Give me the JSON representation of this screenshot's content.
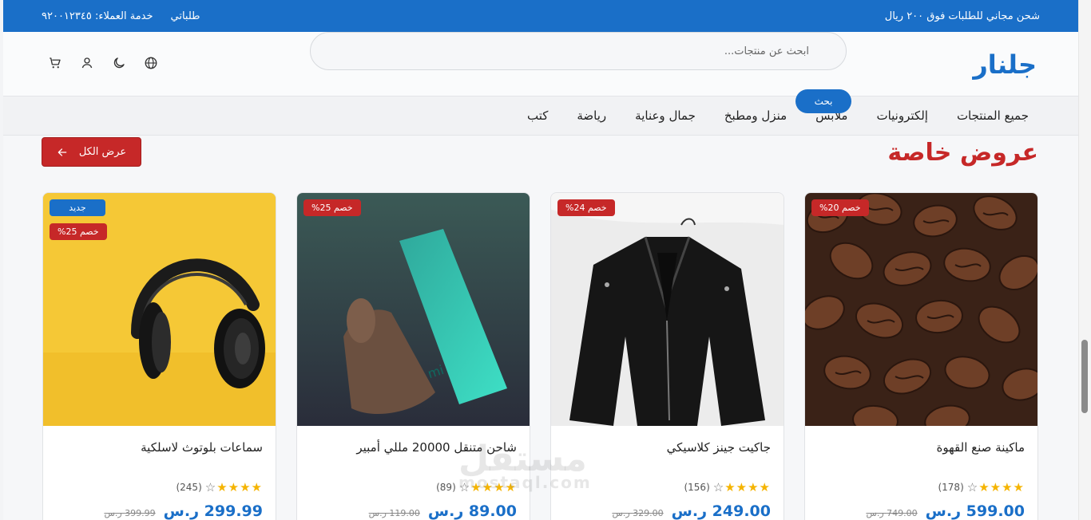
{
  "topbar": {
    "promo": "شحن مجاني للطلبات فوق ٢٠٠ ريال",
    "orders": "طلباتي",
    "support": "خدمة العملاء: ٩٢٠٠١٢٣٤٥"
  },
  "header": {
    "logo": "جلنار",
    "search_placeholder": "ابحث عن منتجات...",
    "search_button": "بحث"
  },
  "nav": {
    "items": [
      "جميع المنتجات",
      "إلكترونيات",
      "ملابس",
      "منزل ومطبخ",
      "جمال وعناية",
      "رياضة",
      "كتب"
    ]
  },
  "section": {
    "title": "عروض خاصة",
    "view_all": "عرض الكل"
  },
  "products": [
    {
      "name": "سماعات بلوتوث لاسلكية",
      "badge_new": "جديد",
      "discount": "خصم 25%",
      "reviews": "(245)",
      "rating": 4,
      "price": "299.99 ر.س",
      "old_price": "399.99 ر.س"
    },
    {
      "name": "شاحن متنقل 20000 مللي أمبير",
      "discount": "خصم 25%",
      "reviews": "(89)",
      "rating": 4,
      "price": "89.00 ر.س",
      "old_price": "119.00 ر.س"
    },
    {
      "name": "جاكيت جينز كلاسيكي",
      "discount": "خصم 24%",
      "reviews": "(156)",
      "rating": 4,
      "price": "249.00 ر.س",
      "old_price": "329.00 ر.س"
    },
    {
      "name": "ماكينة صنع القهوة",
      "discount": "خصم 20%",
      "reviews": "(178)",
      "rating": 4,
      "price": "599.00 ر.س",
      "old_price": "749.00 ر.س"
    }
  ],
  "watermark": {
    "text": "مستقل",
    "sub": "mostaql.com"
  },
  "colors": {
    "primary": "#1a6fc8",
    "accent": "#c62828"
  },
  "icons": {
    "header": [
      "globe-icon",
      "moon-icon",
      "user-icon",
      "cart-icon"
    ]
  }
}
